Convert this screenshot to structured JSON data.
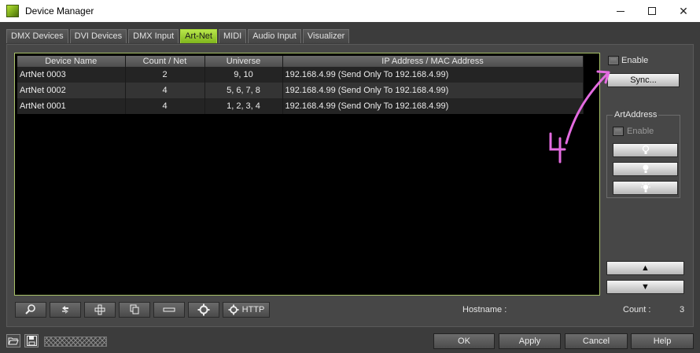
{
  "window": {
    "title": "Device Manager",
    "minimize_glyph": "—",
    "maximize_glyph": "□",
    "close_glyph": "✕"
  },
  "tabs": [
    {
      "label": "DMX Devices",
      "active": false
    },
    {
      "label": "DVI Devices",
      "active": false
    },
    {
      "label": "DMX Input",
      "active": false
    },
    {
      "label": "Art-Net",
      "active": true
    },
    {
      "label": "MIDI",
      "active": false
    },
    {
      "label": "Audio Input",
      "active": false
    },
    {
      "label": "Visualizer",
      "active": false
    }
  ],
  "table": {
    "columns": [
      "Device Name",
      "Count / Net",
      "Universe",
      "IP Address / MAC Address"
    ],
    "rows": [
      [
        "ArtNet 0003",
        "2",
        "9, 10",
        "192.168.4.99 (Send Only To 192.168.4.99)"
      ],
      [
        "ArtNet 0002",
        "4",
        "5, 6, 7, 8",
        "192.168.4.99 (Send Only To 192.168.4.99)"
      ],
      [
        "ArtNet 0001",
        "4",
        "1, 2, 3, 4",
        "192.168.4.99 (Send Only To 192.168.4.99)"
      ]
    ]
  },
  "toolbar": {
    "search_icon": "search-icon",
    "refresh_icon": "refresh-icon",
    "add_icon": "add-icon",
    "duplicate_icon": "duplicate-icon",
    "remove_icon": "remove-icon",
    "settings_icon": "gear-icon",
    "http_label": "HTTP"
  },
  "status": {
    "hostname_label": "Hostname :",
    "hostname_value": "",
    "count_label": "Count :",
    "count_value": "3"
  },
  "right_panel": {
    "enable_label": "Enable",
    "enable_checked": false,
    "sync_label": "Sync...",
    "artaddress": {
      "title": "ArtAddress",
      "enable_label": "Enable",
      "enable_checked": false
    },
    "up_arrow": "▲",
    "down_arrow": "▼"
  },
  "footer": {
    "ok_label": "OK",
    "apply_label": "Apply",
    "cancel_label": "Cancel",
    "help_label": "Help"
  },
  "annotation": {
    "handwritten_text": "4",
    "color": "#e36be0"
  },
  "colors": {
    "accent_green": "#8cc63f",
    "panel_bg": "#474747",
    "list_border": "#a8c268"
  }
}
